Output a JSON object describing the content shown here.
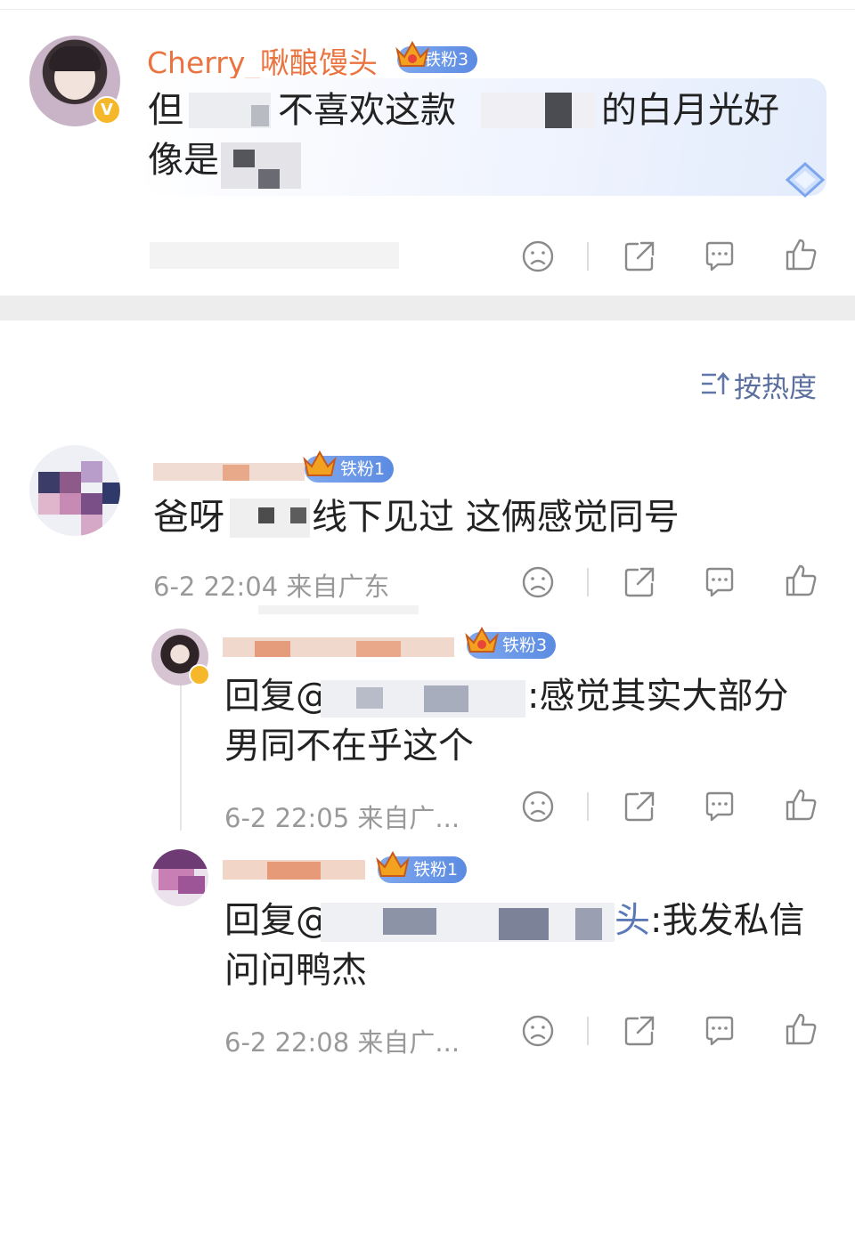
{
  "top_comment": {
    "username": "Cherry_啾酿馒头",
    "badge": "铁粉3",
    "text_visible": [
      "但",
      "不喜欢这款",
      "的白月光好",
      "像是"
    ]
  },
  "sort": {
    "icon": "sort-hot-icon",
    "label": "按热度"
  },
  "comments": [
    {
      "badge": "铁粉1",
      "text_visible": [
        "爸呀",
        "线下见过 这俩感觉同号"
      ],
      "time": "6-2 22:04",
      "location": "来自广东"
    }
  ],
  "replies": [
    {
      "username_visible": "_",
      "badge": "铁粉3",
      "prefix": "回复@",
      "text_visible": [
        ":感觉其实大部分",
        "男同不在乎这个"
      ],
      "time": "6-2 22:05",
      "location": "来自广..."
    },
    {
      "badge": "铁粉1",
      "prefix": "回复@",
      "mention_tail": "头",
      "text_visible": [
        ":我发私信",
        "问问鸭杰"
      ],
      "time": "6-2 22:08",
      "location": "来自广..."
    }
  ],
  "actions": [
    "dislike-icon",
    "share-icon",
    "comment-icon",
    "like-icon"
  ],
  "colors": {
    "username": "#eb7340",
    "badge": "#5b8be2",
    "link": "#5a79b8",
    "meta": "#999999",
    "divider": "#ededed"
  }
}
